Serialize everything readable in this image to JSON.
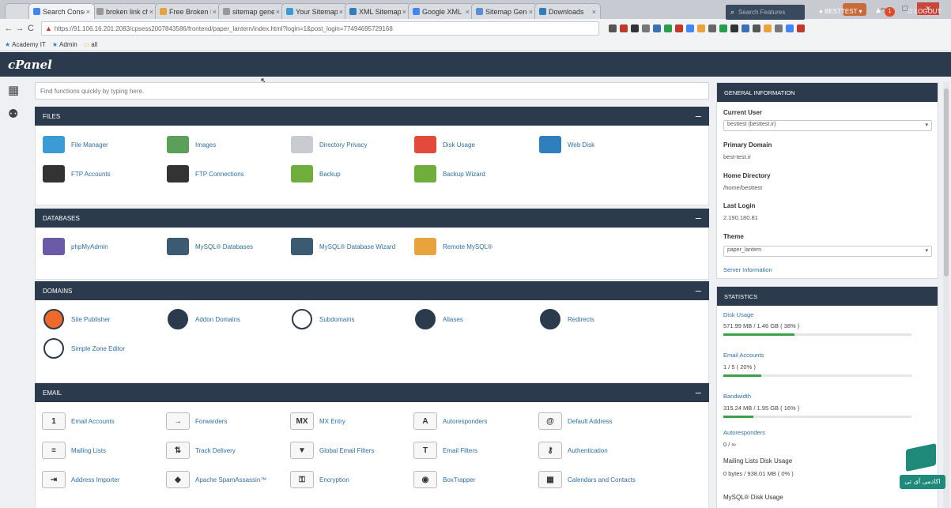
{
  "browser": {
    "tabs": [
      {
        "label": "Search Console",
        "color": "#4285f4"
      },
      {
        "label": "broken link chec",
        "color": "#999999"
      },
      {
        "label": "Free Broken Link",
        "color": "#e8a33d"
      },
      {
        "label": "sitemap generat",
        "color": "#999999"
      },
      {
        "label": "Your Sitemap Do",
        "color": "#3a9bd5"
      },
      {
        "label": "XML Sitemap Ge",
        "color": "#2f7fbf"
      },
      {
        "label": "Google XML Site",
        "color": "#4285f4"
      },
      {
        "label": "Sitemap Generat",
        "color": "#5a8fd0"
      },
      {
        "label": "Downloads",
        "color": "#2f7fbf"
      }
    ],
    "tab_close": "×",
    "window_controls": {
      "minimize": "–",
      "maximize": "□",
      "close": "×"
    },
    "nav": {
      "back": "←",
      "forward": "→",
      "reload": "C"
    },
    "url": "https://91.106.16.201:2083/cpsess2007843586/frontend/paper_lantern/index.html?login=1&post_login=77494695729168",
    "bookmarks": [
      "Academy IT",
      "Admin",
      "all"
    ],
    "extension_colors": [
      "#555555",
      "#c0392b",
      "#333333",
      "#777777",
      "#3c6fb4",
      "#2a9d4b",
      "#c0392b",
      "#4285f4",
      "#e8a33d",
      "#666666",
      "#2a9d4b",
      "#333333",
      "#3c6fb4",
      "#555555",
      "#e8a33d",
      "#777777",
      "#4285f4",
      "#c0392b"
    ]
  },
  "cpanel": {
    "logo": "cPanel",
    "search_placeholder": "Search Features",
    "user": "BESTTEST",
    "notifications": "1",
    "logout": "LOGOUT",
    "quick_search_placeholder": "Find functions quickly by typing here."
  },
  "sections": [
    {
      "title": "FILES",
      "items": [
        {
          "label": "File Manager",
          "icon": "file-manager-icon",
          "color": "#3a9bd5"
        },
        {
          "label": "Images",
          "icon": "images-icon",
          "color": "#5aa05a"
        },
        {
          "label": "Directory Privacy",
          "icon": "folder-lock-icon",
          "color": "#c8ccd0"
        },
        {
          "label": "Disk Usage",
          "icon": "disk-usage-icon",
          "color": "#e24b3b"
        },
        {
          "label": "Web Disk",
          "icon": "cloud-icon",
          "color": "#2f7fbf"
        },
        {
          "label": "FTP Accounts",
          "icon": "ftp-accounts-icon",
          "color": "#333333"
        },
        {
          "label": "FTP Connections",
          "icon": "ftp-connections-icon",
          "color": "#333333"
        },
        {
          "label": "Backup",
          "icon": "backup-icon",
          "color": "#6fae3c"
        },
        {
          "label": "Backup Wizard",
          "icon": "backup-wizard-icon",
          "color": "#6fae3c"
        }
      ]
    },
    {
      "title": "DATABASES",
      "items": [
        {
          "label": "phpMyAdmin",
          "icon": "phpmyadmin-icon",
          "color": "#6a5aa8"
        },
        {
          "label": "MySQL® Databases",
          "icon": "mysql-databases-icon",
          "color": "#3d5a73"
        },
        {
          "label": "MySQL® Database Wizard",
          "icon": "mysql-wizard-icon",
          "color": "#3d5a73"
        },
        {
          "label": "Remote MySQL®",
          "icon": "remote-mysql-icon",
          "color": "#e8a33d"
        }
      ]
    },
    {
      "title": "DOMAINS",
      "items": [
        {
          "label": "Site Publisher",
          "icon": "site-publisher-icon",
          "color": "#ee6a2b"
        },
        {
          "label": "Addon Domains",
          "icon": "addon-domains-icon",
          "color": "#2b3a4c"
        },
        {
          "label": "Subdomains",
          "icon": "subdomains-icon",
          "color": "#ffffff"
        },
        {
          "label": "Aliases",
          "icon": "aliases-icon",
          "color": "#2b3a4c"
        },
        {
          "label": "Redirects",
          "icon": "redirects-icon",
          "color": "#2b3a4c"
        },
        {
          "label": "Simple Zone Editor",
          "icon": "dns-icon",
          "color": "#ffffff"
        }
      ]
    },
    {
      "title": "EMAIL",
      "items": [
        {
          "label": "Email Accounts",
          "icon": "email-accounts-icon",
          "glyph": "1"
        },
        {
          "label": "Forwarders",
          "icon": "forwarders-icon",
          "glyph": "→"
        },
        {
          "label": "MX Entry",
          "icon": "mx-entry-icon",
          "glyph": "MX"
        },
        {
          "label": "Autoresponders",
          "icon": "autoresponders-icon",
          "glyph": "A"
        },
        {
          "label": "Default Address",
          "icon": "default-address-icon",
          "glyph": "@"
        },
        {
          "label": "Mailing Lists",
          "icon": "mailing-lists-icon",
          "glyph": "≡"
        },
        {
          "label": "Track Delivery",
          "icon": "track-delivery-icon",
          "glyph": "⇅"
        },
        {
          "label": "Global Email Filters",
          "icon": "global-filters-icon",
          "glyph": "▼"
        },
        {
          "label": "Email Filters",
          "icon": "email-filters-icon",
          "glyph": "T"
        },
        {
          "label": "Authentication",
          "icon": "authentication-icon",
          "glyph": "⚷"
        },
        {
          "label": "Address Importer",
          "icon": "address-importer-icon",
          "glyph": "⇥"
        },
        {
          "label": "Apache SpamAssassin™",
          "icon": "spamassassin-icon",
          "glyph": "◆"
        },
        {
          "label": "Encryption",
          "icon": "encryption-icon",
          "glyph": "⚿"
        },
        {
          "label": "BoxTrapper",
          "icon": "boxtrapper-icon",
          "glyph": "◉"
        },
        {
          "label": "Calendars and Contacts",
          "icon": "calendars-icon",
          "glyph": "▦"
        }
      ]
    }
  ],
  "general_info": {
    "title": "GENERAL INFORMATION",
    "current_user_label": "Current User",
    "current_user_value": "besttest (besttest.ir)",
    "primary_domain_label": "Primary Domain",
    "primary_domain_value": "best-test.ir",
    "home_directory_label": "Home Directory",
    "home_directory_value": "/home/besttest",
    "last_login_label": "Last Login",
    "last_login_value": "2.190.180.81",
    "theme_label": "Theme",
    "theme_value": "paper_lantern",
    "server_info_link": "Server Information"
  },
  "statistics": {
    "title": "STATISTICS",
    "items": [
      {
        "label": "Disk Usage",
        "value": "571.99 MB / 1.46 GB ( 38% )",
        "percent": 38
      },
      {
        "label": "Email Accounts",
        "value": "1 / 5 ( 20% )",
        "percent": 20
      },
      {
        "label": "Bandwidth",
        "value": "315.24 MB / 1.95 GB ( 16% )",
        "percent": 16
      },
      {
        "label": "Autoresponders",
        "value": "0 / ∞"
      },
      {
        "label": "Mailing Lists Disk Usage",
        "value": "0 bytes / 938.01 MB ( 0% )"
      },
      {
        "label": "MySQL® Disk Usage",
        "value": ""
      }
    ]
  },
  "brand": {
    "text": "اکادمی آی تی"
  }
}
